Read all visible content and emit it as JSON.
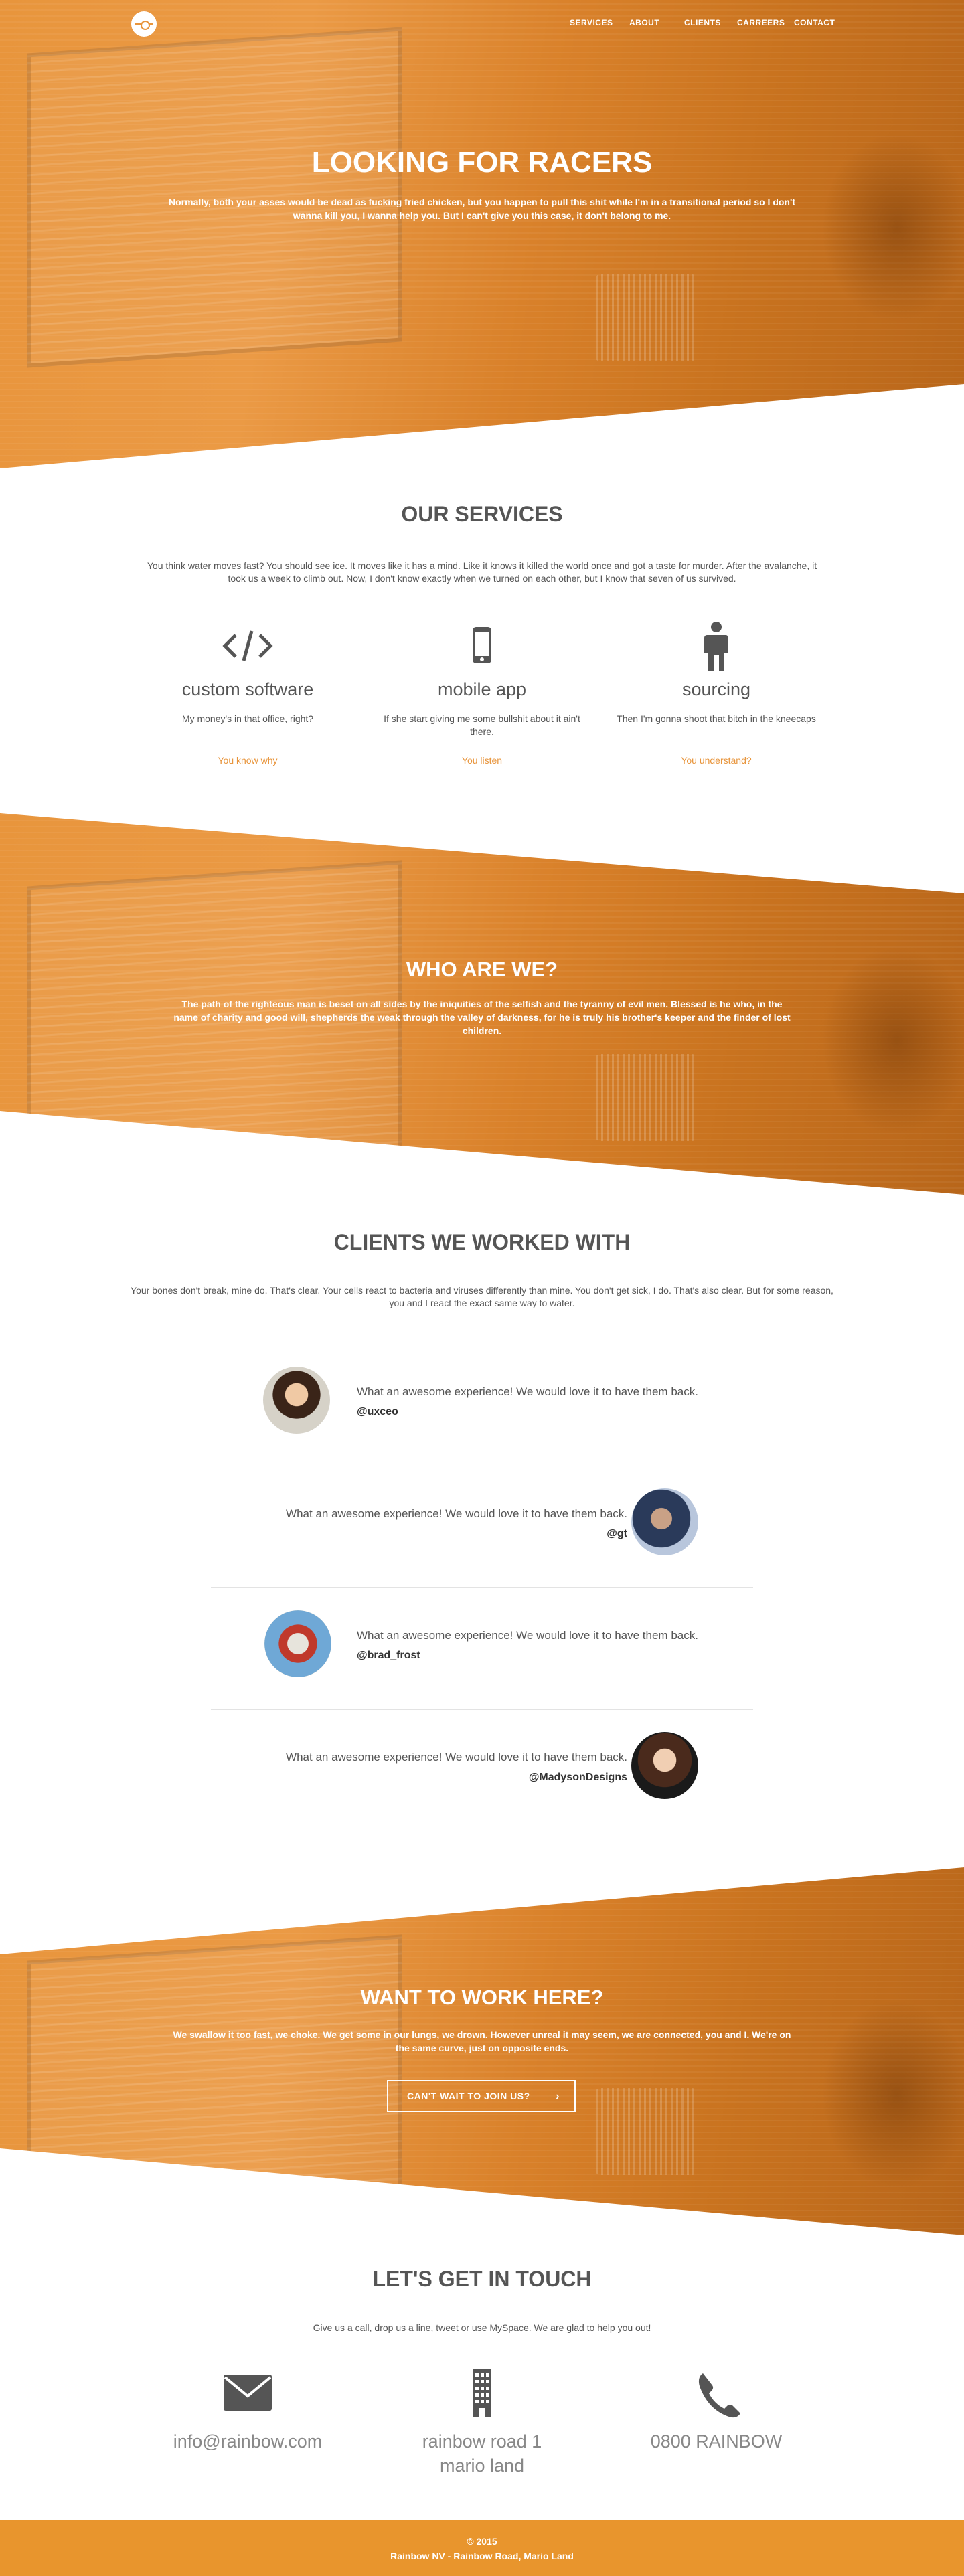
{
  "nav": {
    "logo": "Rainbow",
    "links": [
      "SERVICES",
      "ABOUT",
      "CLIENTS",
      "CARREERS",
      "CONTACT"
    ]
  },
  "hero": {
    "title": "LOOKING FOR RACERS",
    "subtitle": "Normally, both your asses would be dead as fucking fried chicken, but you happen to pull this shit while I'm in a transitional period so I don't wanna kill you, I wanna help you. But I can't give you this case, it don't belong to me."
  },
  "services": {
    "title": "OUR SERVICES",
    "intro": "You think water moves fast? You should see ice. It moves like it has a mind. Like it knows it killed the world once and got a taste for murder. After the avalanche, it took us a week to climb out. Now, I don't know exactly when we turned on each other, but I know that seven of us survived.",
    "items": [
      {
        "icon": "code-icon",
        "title": "custom software",
        "text": "My money's in that office, right?",
        "link": "You know why"
      },
      {
        "icon": "mobile-icon",
        "title": "mobile app",
        "text": "If she start giving me some bullshit about it ain't there.",
        "link": "You listen"
      },
      {
        "icon": "person-icon",
        "title": "sourcing",
        "text": "Then I'm gonna shoot that bitch in the kneecaps",
        "link": "You understand?"
      }
    ]
  },
  "who": {
    "title": "WHO ARE WE?",
    "text": "The path of the righteous man is beset on all sides by the iniquities of the selfish and the tyranny of evil men. Blessed is he who, in the name of charity and good will, shepherds the weak through the valley of darkness, for he is truly his brother's keeper and the finder of lost children."
  },
  "clients": {
    "title": "CLIENTS WE WORKED WITH",
    "intro": "Your bones don't break, mine do. That's clear. Your cells react to bacteria and viruses differently than mine. You don't get sick, I do. That's also clear. But for some reason, you and I react the exact same way to water.",
    "items": [
      {
        "quote": "What an awesome experience! We would love it to have them back.",
        "handle": "@uxceo"
      },
      {
        "quote": "What an awesome experience! We would love it to have them back.",
        "handle": "@gt"
      },
      {
        "quote": "What an awesome experience! We would love it to have them back.",
        "handle": "@brad_frost"
      },
      {
        "quote": "What an awesome experience! We would love it to have them back.",
        "handle": "@MadysonDesigns"
      }
    ]
  },
  "join": {
    "title": "WANT TO WORK HERE?",
    "text": "We swallow it too fast, we choke. We get some in our lungs, we drown. However unreal it may seem, we are connected, you and I. We're on the same curve, just on opposite ends.",
    "button": "CAN'T WAIT TO JOIN US?"
  },
  "contact": {
    "title": "LET'S GET IN TOUCH",
    "intro": "Give us a call, drop us a line, tweet or use MySpace. We are glad to help you out!",
    "items": [
      {
        "icon": "envelope-icon",
        "line1": "info@rainbow.com",
        "line2": ""
      },
      {
        "icon": "building-icon",
        "line1": "rainbow road 1",
        "line2": "mario land"
      },
      {
        "icon": "phone-icon",
        "line1": "0800 RAINBOW",
        "line2": ""
      }
    ]
  },
  "footer": {
    "copyright": "© 2015",
    "address": "Rainbow NV - Rainbow Road, Mario Land"
  },
  "colors": {
    "accent": "#e8953c",
    "footer": "#e8952d",
    "text": "#555555"
  }
}
